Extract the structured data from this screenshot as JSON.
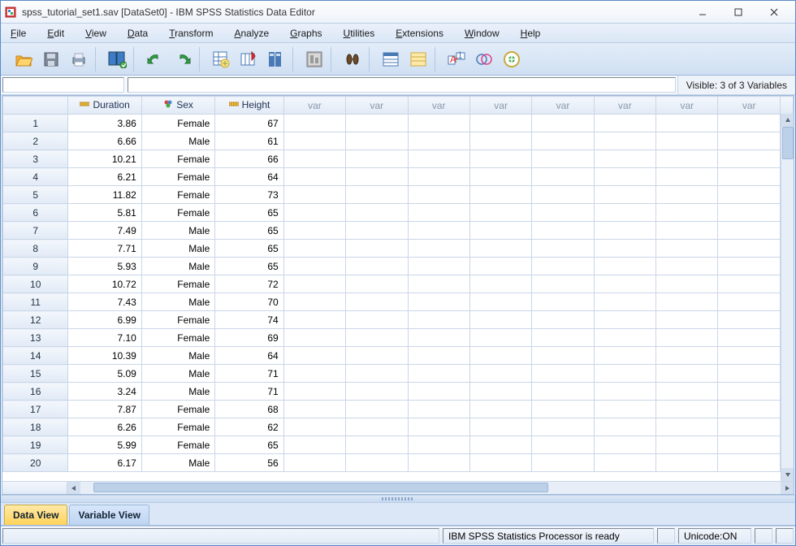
{
  "window": {
    "title": "spss_tutorial_set1.sav [DataSet0] - IBM SPSS Statistics Data Editor"
  },
  "menu": {
    "file": "File",
    "edit": "Edit",
    "view": "View",
    "data": "Data",
    "transform": "Transform",
    "analyze": "Analyze",
    "graphs": "Graphs",
    "utilities": "Utilities",
    "extensions": "Extensions",
    "window": "Window",
    "help": "Help"
  },
  "visible_label": "Visible: 3 of 3 Variables",
  "columns": {
    "duration": "Duration",
    "sex": "Sex",
    "height": "Height",
    "var": "var"
  },
  "rows": [
    {
      "n": "1",
      "duration": "3.86",
      "sex": "Female",
      "height": "67"
    },
    {
      "n": "2",
      "duration": "6.66",
      "sex": "Male",
      "height": "61"
    },
    {
      "n": "3",
      "duration": "10.21",
      "sex": "Female",
      "height": "66"
    },
    {
      "n": "4",
      "duration": "6.21",
      "sex": "Female",
      "height": "64"
    },
    {
      "n": "5",
      "duration": "11.82",
      "sex": "Female",
      "height": "73"
    },
    {
      "n": "6",
      "duration": "5.81",
      "sex": "Female",
      "height": "65"
    },
    {
      "n": "7",
      "duration": "7.49",
      "sex": "Male",
      "height": "65"
    },
    {
      "n": "8",
      "duration": "7.71",
      "sex": "Male",
      "height": "65"
    },
    {
      "n": "9",
      "duration": "5.93",
      "sex": "Male",
      "height": "65"
    },
    {
      "n": "10",
      "duration": "10.72",
      "sex": "Female",
      "height": "72"
    },
    {
      "n": "11",
      "duration": "7.43",
      "sex": "Male",
      "height": "70"
    },
    {
      "n": "12",
      "duration": "6.99",
      "sex": "Female",
      "height": "74"
    },
    {
      "n": "13",
      "duration": "7.10",
      "sex": "Female",
      "height": "69"
    },
    {
      "n": "14",
      "duration": "10.39",
      "sex": "Male",
      "height": "64"
    },
    {
      "n": "15",
      "duration": "5.09",
      "sex": "Male",
      "height": "71"
    },
    {
      "n": "16",
      "duration": "3.24",
      "sex": "Male",
      "height": "71"
    },
    {
      "n": "17",
      "duration": "7.87",
      "sex": "Female",
      "height": "68"
    },
    {
      "n": "18",
      "duration": "6.26",
      "sex": "Female",
      "height": "62"
    },
    {
      "n": "19",
      "duration": "5.99",
      "sex": "Female",
      "height": "65"
    },
    {
      "n": "20",
      "duration": "6.17",
      "sex": "Male",
      "height": "56"
    }
  ],
  "tabs": {
    "data_view": "Data View",
    "variable_view": "Variable View"
  },
  "status": {
    "processor": "IBM SPSS Statistics Processor is ready",
    "unicode": "Unicode:ON"
  }
}
